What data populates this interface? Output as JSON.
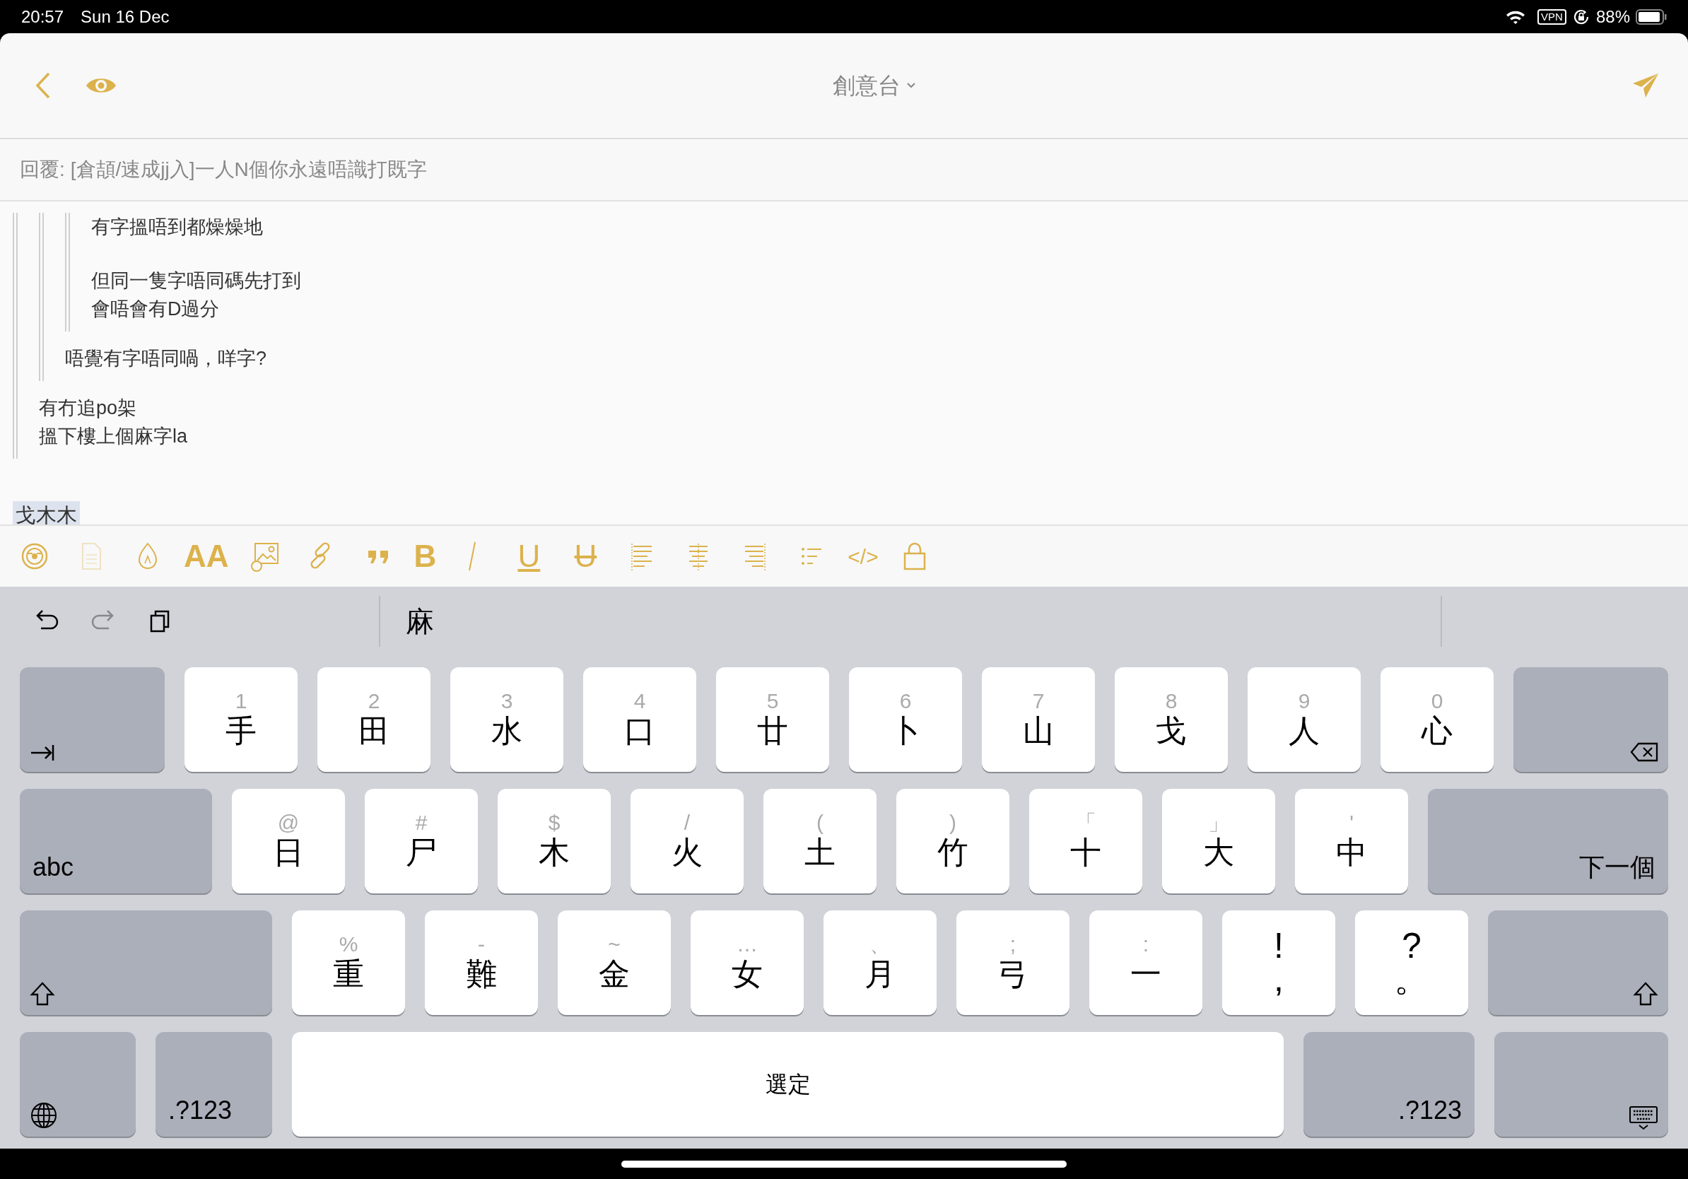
{
  "status_bar": {
    "time": "20:57",
    "date": "Sun 16 Dec",
    "vpn": "VPN",
    "battery": "88%"
  },
  "header": {
    "title": "創意台"
  },
  "reply": {
    "label": "回覆:",
    "subject": "[倉頡/速成jj入]一人N個你永遠唔識打既字"
  },
  "post": {
    "quote": {
      "quote": {
        "quote": {
          "paragraphs": [
            "有字搵唔到都燥燥地"
          ],
          "more_paragraphs": [
            "但同一隻字唔同碼先打到",
            "會唔會有D過分"
          ]
        },
        "paragraphs": [
          "唔覺有字唔同喎，咩字?"
        ]
      },
      "paragraphs": [
        "有冇追po架",
        "搵下樓上個麻字la"
      ]
    }
  },
  "draft": {
    "text": "戈木木",
    "marked": true
  },
  "toolbar": {
    "tools": [
      {
        "kind": "emoji",
        "disabled": false
      },
      {
        "kind": "document",
        "disabled": true
      },
      {
        "kind": "color",
        "disabled": false
      },
      {
        "kind": "text",
        "label": "AA",
        "disabled": false
      },
      {
        "kind": "image",
        "disabled": false
      },
      {
        "kind": "link",
        "disabled": false
      },
      {
        "kind": "quote",
        "disabled": false
      },
      {
        "kind": "text",
        "label": "B",
        "disabled": false
      },
      {
        "kind": "italic",
        "disabled": false
      },
      {
        "kind": "underline",
        "label": "U",
        "disabled": false
      },
      {
        "kind": "strike",
        "label": "U",
        "disabled": false
      },
      {
        "kind": "align-left",
        "disabled": false
      },
      {
        "kind": "align-center",
        "disabled": false
      },
      {
        "kind": "align-right",
        "disabled": false
      },
      {
        "kind": "list",
        "disabled": false
      },
      {
        "kind": "text",
        "label": "</>",
        "disabled": false
      },
      {
        "kind": "lock",
        "disabled": false
      }
    ]
  },
  "keyboard": {
    "edit_tools": [
      {
        "kind": "undo",
        "disabled": false
      },
      {
        "kind": "redo",
        "disabled": true
      },
      {
        "kind": "clipboard",
        "disabled": false
      }
    ],
    "candidates": [
      "麻"
    ],
    "rows": [
      [
        {
          "kind": "tab"
        },
        {
          "kind": "char",
          "hint": "1",
          "label": "手"
        },
        {
          "kind": "char",
          "hint": "2",
          "label": "田"
        },
        {
          "kind": "char",
          "hint": "3",
          "label": "水"
        },
        {
          "kind": "char",
          "hint": "4",
          "label": "口"
        },
        {
          "kind": "char",
          "hint": "5",
          "label": "廿"
        },
        {
          "kind": "char",
          "hint": "6",
          "label": "卜"
        },
        {
          "kind": "char",
          "hint": "7",
          "label": "山"
        },
        {
          "kind": "char",
          "hint": "8",
          "label": "戈"
        },
        {
          "kind": "char",
          "hint": "9",
          "label": "人"
        },
        {
          "kind": "char",
          "hint": "0",
          "label": "心"
        },
        {
          "kind": "delete"
        }
      ],
      [
        {
          "kind": "label",
          "label": "abc"
        },
        {
          "kind": "char",
          "hint": "@",
          "label": "日"
        },
        {
          "kind": "char",
          "hint": "#",
          "label": "尸"
        },
        {
          "kind": "char",
          "hint": "$",
          "label": "木"
        },
        {
          "kind": "char",
          "hint": "/",
          "label": "火"
        },
        {
          "kind": "char",
          "hint": "(",
          "label": "土"
        },
        {
          "kind": "char",
          "hint": ")",
          "label": "竹"
        },
        {
          "kind": "char",
          "hint": "「",
          "label": "十"
        },
        {
          "kind": "char",
          "hint": "」",
          "label": "大"
        },
        {
          "kind": "char",
          "hint": "'",
          "label": "中"
        },
        {
          "kind": "label",
          "label": "下一個"
        }
      ],
      [
        {
          "kind": "shift"
        },
        {
          "kind": "char",
          "hint": "%",
          "label": "重"
        },
        {
          "kind": "char",
          "hint": "-",
          "label": "難"
        },
        {
          "kind": "char",
          "hint": "~",
          "label": "金"
        },
        {
          "kind": "char",
          "hint": "…",
          "label": "女"
        },
        {
          "kind": "char",
          "hint": "、",
          "label": "月"
        },
        {
          "kind": "char",
          "hint": ";",
          "label": "弓"
        },
        {
          "kind": "char",
          "hint": ":",
          "label": "一"
        },
        {
          "kind": "punct",
          "hint": "!",
          "label": ","
        },
        {
          "kind": "punct",
          "hint": "?",
          "label": "。"
        },
        {
          "kind": "shift"
        }
      ],
      [
        {
          "kind": "globe"
        },
        {
          "kind": "label",
          "label": ".?123"
        },
        {
          "kind": "space",
          "label": "選定"
        },
        {
          "kind": "label",
          "label": ".?123"
        },
        {
          "kind": "hide"
        }
      ]
    ]
  }
}
